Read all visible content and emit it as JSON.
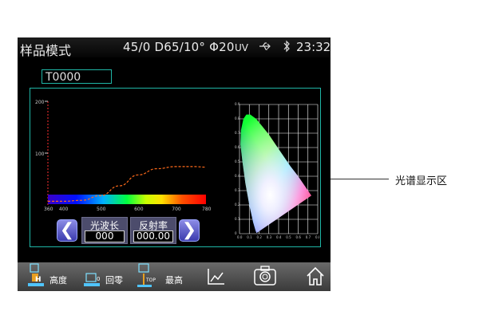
{
  "status": {
    "mode": "样品模式",
    "conditions": "45/0 D65/10° Φ20",
    "uv": "UV",
    "time": "23:32",
    "icons": [
      "usb-icon",
      "bluetooth-icon"
    ]
  },
  "sample_id": "T0000",
  "spectrum": {
    "y_ticks": [
      "200",
      "100",
      "0"
    ],
    "x_ticks": [
      "360",
      "400",
      "500",
      "600",
      "700",
      "780"
    ],
    "curve_color": "#ff6a1a",
    "chart_data": {
      "type": "line",
      "x": [
        360,
        400,
        450,
        500,
        550,
        600,
        650,
        700,
        750,
        780
      ],
      "y": [
        7,
        7,
        9,
        18,
        37,
        58,
        70,
        74,
        74,
        73
      ],
      "ylim": [
        0,
        200
      ],
      "xlim": [
        360,
        780
      ]
    }
  },
  "wave_field": {
    "label": "光波长",
    "value": "000"
  },
  "refl_field": {
    "label": "反射率",
    "value": "000.00"
  },
  "cie_ticks_x": [
    "0.0",
    "0.1",
    "0.2",
    "0.3",
    "0.4",
    "0.5",
    "0.6",
    "0.7",
    "0.8"
  ],
  "cie_ticks_y": [
    "0.9",
    "0.8",
    "0.7",
    "0.6",
    "0.5",
    "0.4",
    "0.3",
    "0.2",
    "0.1",
    "0"
  ],
  "toolbar": {
    "height_label": "高度",
    "zero_label": "回零",
    "top_label": "最高",
    "items": [
      "height-icon",
      "zero-icon",
      "top-icon",
      "chart-icon",
      "camera-icon",
      "home-icon"
    ]
  },
  "callout": "光谱显示区"
}
